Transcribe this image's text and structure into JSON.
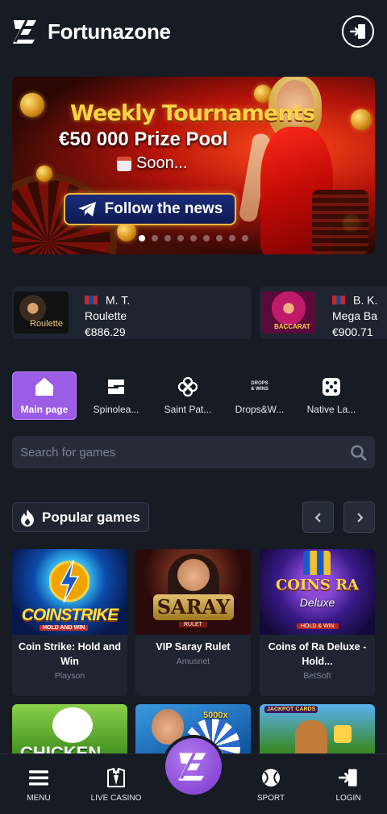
{
  "header": {
    "brand": "Fortunazone"
  },
  "banner": {
    "line1": "Weekly Tournaments",
    "line2": "€50 000 Prize Pool",
    "line3": "Soon...",
    "button_label": "Follow the news",
    "slide_count": 9,
    "active_slide": 1
  },
  "winners": [
    {
      "flag": "mongolia-flag",
      "name": "M. T.",
      "game": "Roulette",
      "amount": "€886.29",
      "thumb_label": "Roulette"
    },
    {
      "flag": "mongolia-flag",
      "name": "B. K.",
      "game": "Mega Ba",
      "amount": "€900.71",
      "thumb_label": "BACCARAT"
    }
  ],
  "tabs": [
    {
      "label": "Main page",
      "icon": "home-icon",
      "active": true
    },
    {
      "label": "Spinolea...",
      "icon": "spinoleague-icon",
      "active": false
    },
    {
      "label": "Saint Pat...",
      "icon": "clover-icon",
      "active": false
    },
    {
      "label": "Drops&W...",
      "icon": "drops-wins-icon",
      "active": false
    },
    {
      "label": "Native La...",
      "icon": "dice-icon",
      "active": false
    }
  ],
  "drops_icon_text": "DROPS & WINS",
  "search": {
    "placeholder": "Search for games"
  },
  "popular": {
    "title": "Popular games"
  },
  "games": [
    {
      "title": "Coin Strike: Hold and Win",
      "provider": "Playson",
      "art_text": "COINSTRIKE",
      "art_sub": "HOLD AND WIN"
    },
    {
      "title": "VIP Saray Rulet",
      "provider": "Amusnet",
      "art_text": "SARAY",
      "art_sub": "RULET"
    },
    {
      "title": "Coins of Ra Deluxe - Hold...",
      "provider": "BetSoft",
      "art_text": "COINS RA",
      "art_sub": "HOLD & WIN"
    }
  ],
  "second_row_art": [
    "CHICKEN",
    "5000x",
    "JACKPOT CARDS"
  ],
  "bottom_nav": [
    {
      "label": "MENU",
      "icon": "menu-icon"
    },
    {
      "label": "LIVE CASINO",
      "icon": "tuxedo-icon"
    },
    {
      "label": "SPORT",
      "icon": "ball-icon"
    },
    {
      "label": "LOGIN",
      "icon": "login-icon"
    }
  ],
  "colors": {
    "background": "#161b24",
    "card": "#1f2530",
    "accent": "#9b5de5",
    "banner_button_border": "#f5b640"
  }
}
